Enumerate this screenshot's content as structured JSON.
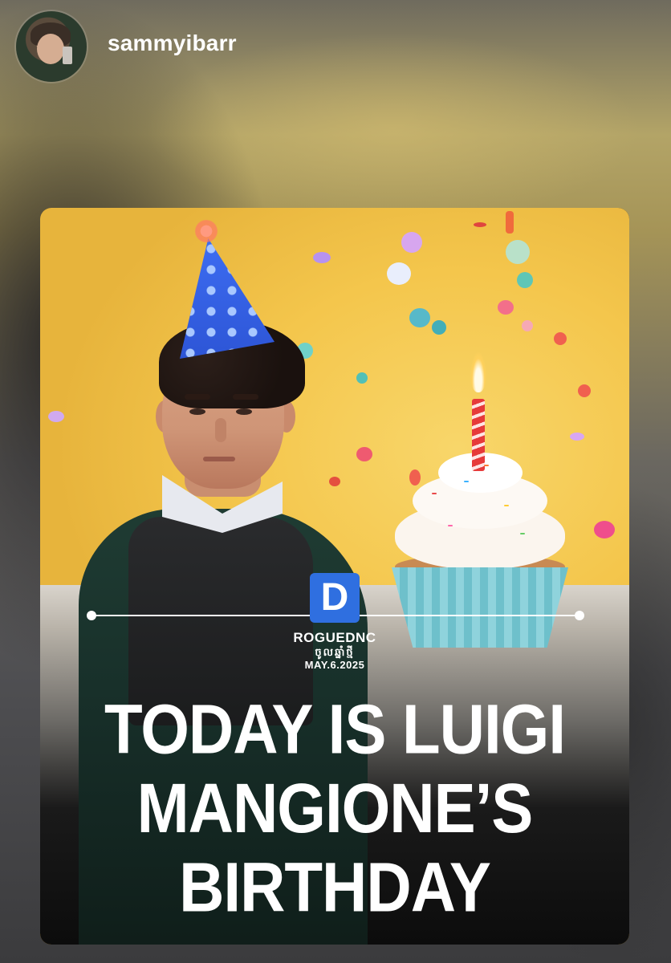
{
  "header": {
    "username": "sammyibarr",
    "avatar_icon": "profile-avatar"
  },
  "post": {
    "logo_letter": "D",
    "brand_name": "ROGUEDNC",
    "brand_script": "ចូលឆ្នាំថ្មី",
    "date": "MAY.6.2025",
    "headline_lines": [
      "TODAY IS LUIGI",
      "MANGIONE’S",
      "BIRTHDAY"
    ],
    "colors": {
      "logo_blue": "#2f6fe0",
      "background_yellow": "#f4c64c",
      "hat_blue": "#3d6df2",
      "text": "#ffffff"
    }
  }
}
